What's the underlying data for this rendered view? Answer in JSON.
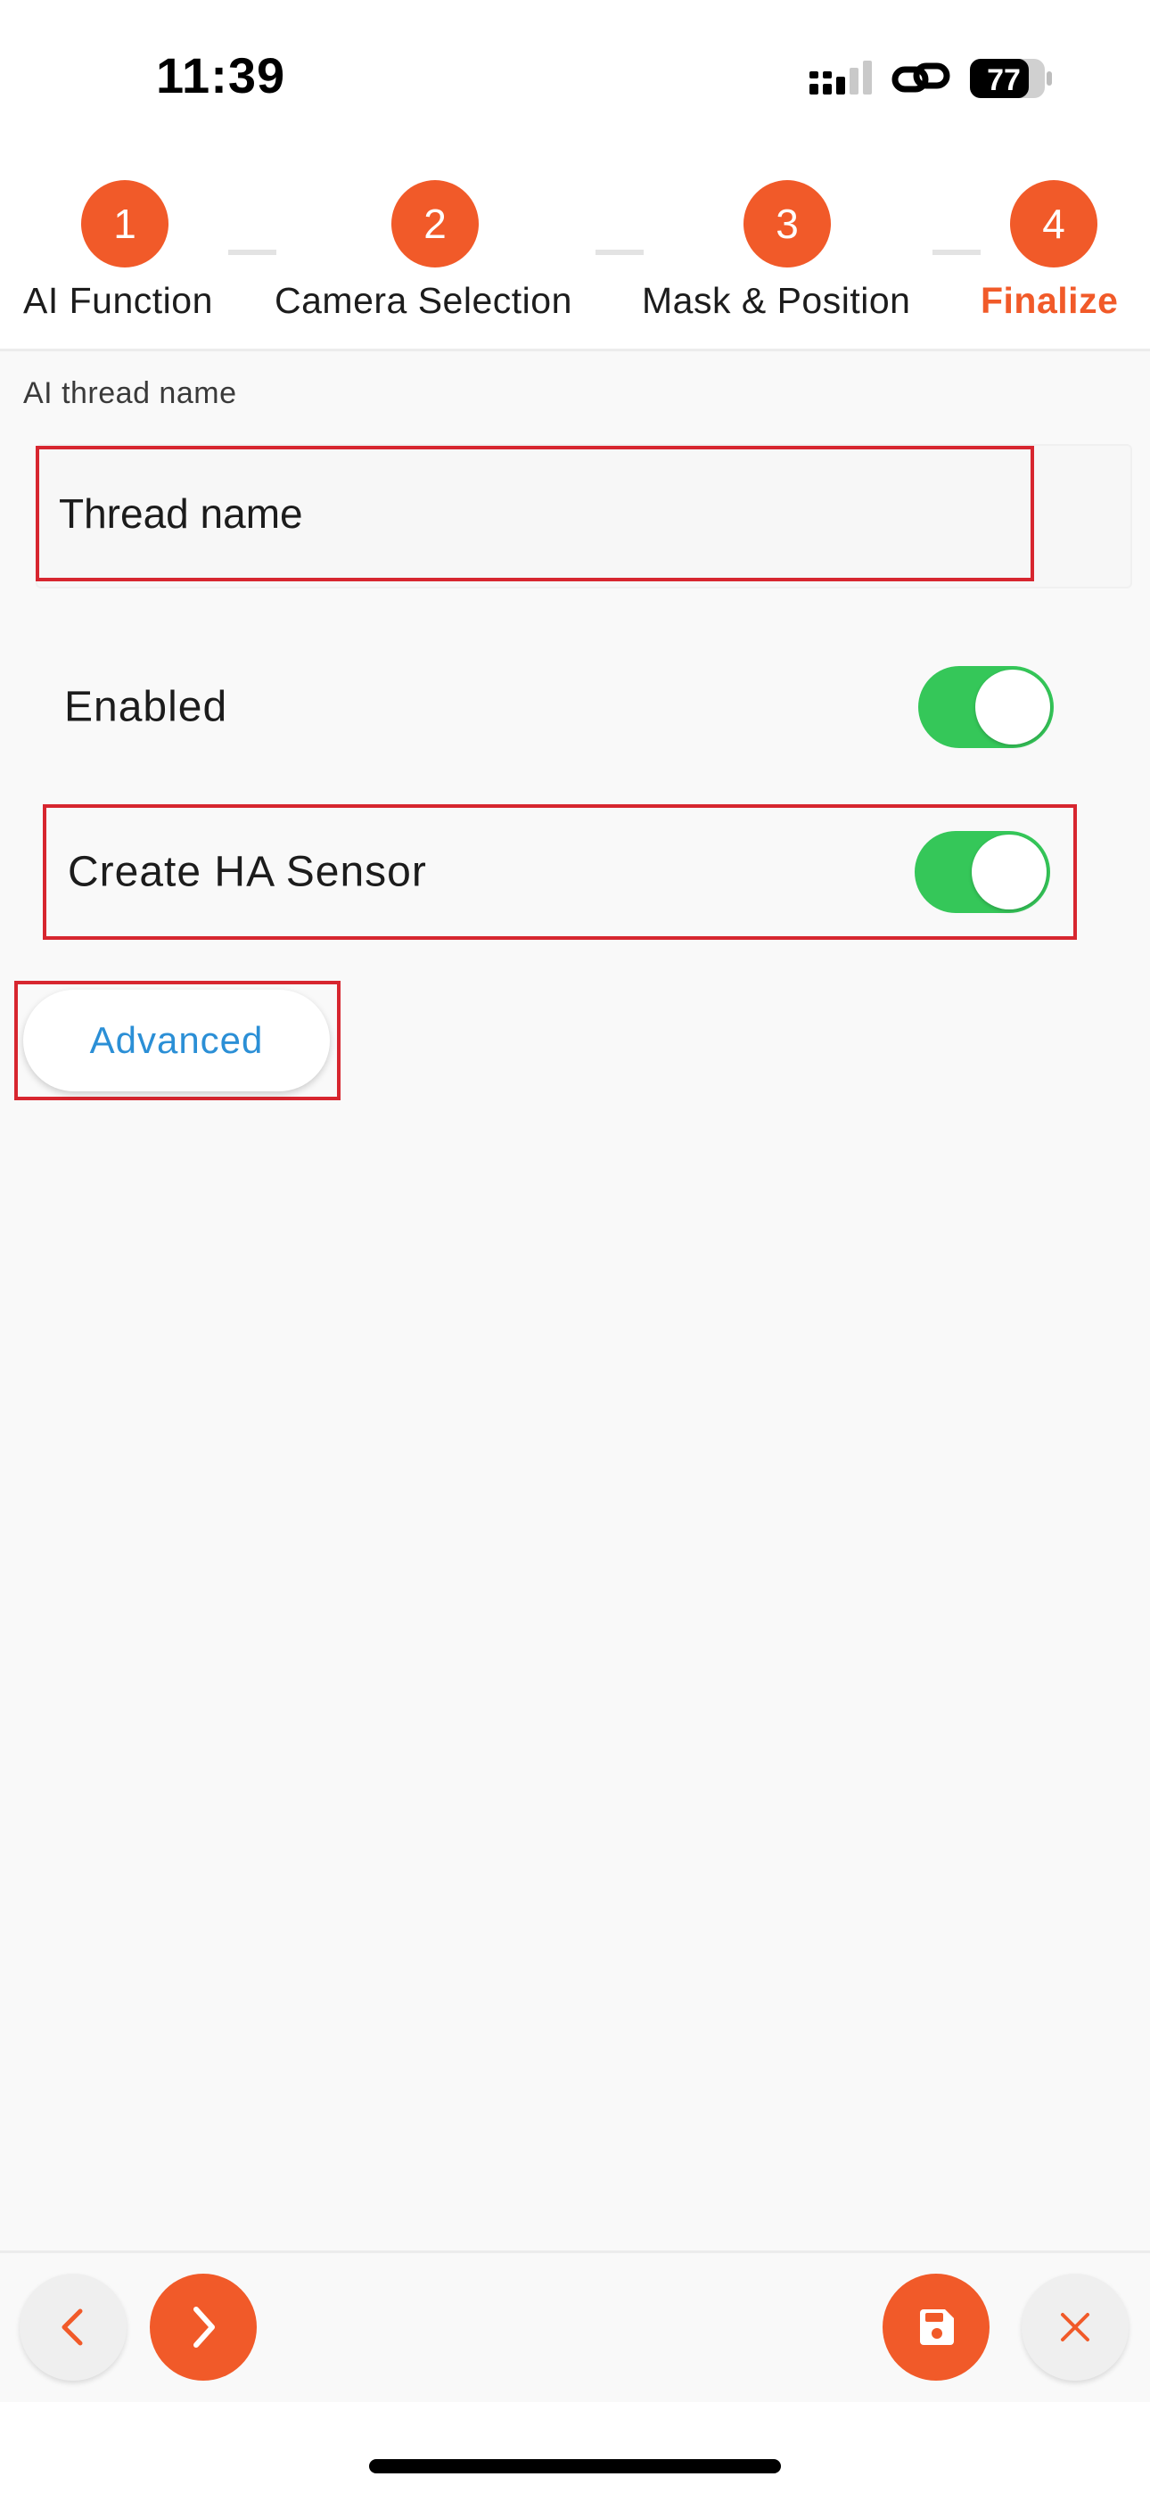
{
  "status_bar": {
    "time": "11:39",
    "battery": "77"
  },
  "stepper": {
    "steps": [
      {
        "number": "1",
        "label": "AI Function"
      },
      {
        "number": "2",
        "label": "Camera Selection"
      },
      {
        "number": "3",
        "label": "Mask & Position"
      },
      {
        "number": "4",
        "label": "Finalize"
      }
    ],
    "active_step": "4"
  },
  "form": {
    "thread_label": "AI thread name",
    "thread_placeholder": "Thread name",
    "enabled_label": "Enabled",
    "enabled_on": true,
    "sensor_label": "Create HA Sensor",
    "sensor_on": true,
    "advanced_label": "Advanced"
  },
  "colors": {
    "accent": "#f15a29",
    "toggle_on": "#35c759",
    "link": "#2b8fd6",
    "highlight": "#d7262f"
  },
  "icons": {
    "back": "chevron-left-icon",
    "next": "chevron-right-icon",
    "save": "floppy-disk-icon",
    "close": "close-icon"
  }
}
